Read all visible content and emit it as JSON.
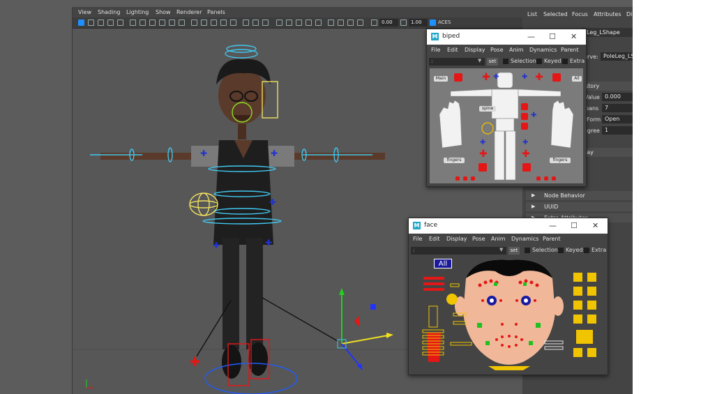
{
  "viewport": {
    "menu": [
      "View",
      "Shading",
      "Lighting",
      "Show",
      "Renderer",
      "Panels"
    ],
    "exposure": "0.00",
    "gamma": "1.00",
    "color_space": "ACES"
  },
  "attribute_editor": {
    "tabs": [
      "List",
      "Selected",
      "Focus",
      "Attributes",
      "Di"
    ],
    "node_tab": "_Leg_LShape",
    "curve_label": "urve:",
    "curve_value": "PoleLeg_LSh",
    "history_section": "story",
    "rows": [
      {
        "label": "Value",
        "value": "0.000"
      },
      {
        "label": "pans",
        "value": "7"
      },
      {
        "label": "Form",
        "value": "Open"
      },
      {
        "label": "egree",
        "value": "1"
      }
    ],
    "display_section": "lay",
    "node_behavior": "Node Behavior",
    "uuid": "UUID",
    "extra_attributes": "Extra Attributes"
  },
  "biped": {
    "title": "biped",
    "menu": [
      "File",
      "Edit",
      "Display",
      "Pose",
      "Anim",
      "Dynamics",
      "Parent"
    ],
    "combo": ":",
    "set_label": "set",
    "checks": [
      "Selection",
      "Keyed",
      "Extra"
    ],
    "labels": {
      "main": "Main",
      "all": "All",
      "spine": "spine",
      "fingers_left": "fingers",
      "fingers_right": "fingers"
    }
  },
  "face": {
    "title": "face",
    "menu": [
      "File",
      "Edit",
      "Display",
      "Pose",
      "Anim",
      "Dynamics",
      "Parent"
    ],
    "combo": ":",
    "set_label": "set",
    "checks": [
      "Selection",
      "Keyed",
      "Extra"
    ],
    "all_label": "All"
  },
  "colors": {
    "accent_red": "#e41616",
    "accent_yellow": "#f0c400",
    "accent_blue": "#2233cc",
    "control_cyan": "#40c8f0"
  }
}
